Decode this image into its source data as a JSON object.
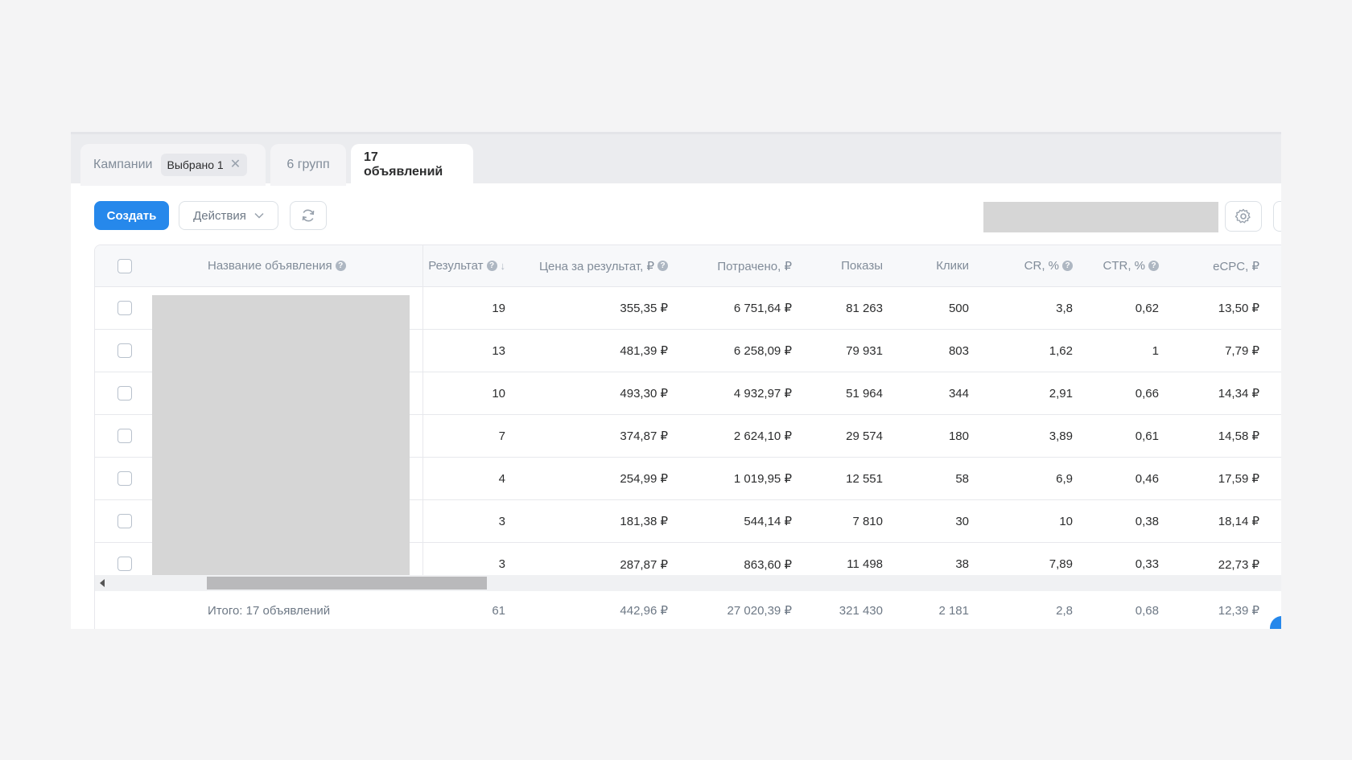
{
  "tabs": {
    "campaigns_label": "Кампании",
    "selected_chip": "Выбрано 1",
    "groups_label": "6 групп",
    "ads_label": "17 объявлений"
  },
  "toolbar": {
    "create_label": "Создать",
    "actions_label": "Действия"
  },
  "table": {
    "headers": {
      "name": "Название объявления",
      "result": "Результат",
      "price": "Цена за результат, ₽",
      "spent": "Потрачено, ₽",
      "shows": "Показы",
      "clicks": "Клики",
      "cr": "CR, %",
      "ctr": "CTR, %",
      "ecpc": "eCPC, ₽"
    },
    "rows": [
      {
        "result": "19",
        "price": "355,35 ₽",
        "spent": "6 751,64 ₽",
        "shows": "81 263",
        "clicks": "500",
        "cr": "3,8",
        "ctr": "0,62",
        "ecpc": "13,50 ₽"
      },
      {
        "result": "13",
        "price": "481,39 ₽",
        "spent": "6 258,09 ₽",
        "shows": "79 931",
        "clicks": "803",
        "cr": "1,62",
        "ctr": "1",
        "ecpc": "7,79 ₽"
      },
      {
        "result": "10",
        "price": "493,30 ₽",
        "spent": "4 932,97 ₽",
        "shows": "51 964",
        "clicks": "344",
        "cr": "2,91",
        "ctr": "0,66",
        "ecpc": "14,34 ₽"
      },
      {
        "result": "7",
        "price": "374,87 ₽",
        "spent": "2 624,10 ₽",
        "shows": "29 574",
        "clicks": "180",
        "cr": "3,89",
        "ctr": "0,61",
        "ecpc": "14,58 ₽"
      },
      {
        "result": "4",
        "price": "254,99 ₽",
        "spent": "1 019,95 ₽",
        "shows": "12 551",
        "clicks": "58",
        "cr": "6,9",
        "ctr": "0,46",
        "ecpc": "17,59 ₽"
      },
      {
        "result": "3",
        "price": "181,38 ₽",
        "spent": "544,14 ₽",
        "shows": "7 810",
        "clicks": "30",
        "cr": "10",
        "ctr": "0,38",
        "ecpc": "18,14 ₽"
      },
      {
        "result": "3",
        "price": "287,87 ₽",
        "spent": "863,60 ₽",
        "shows": "11 498",
        "clicks": "38",
        "cr": "7,89",
        "ctr": "0,33",
        "ecpc": "22,73 ₽"
      }
    ],
    "totals": {
      "label": "Итого: 17 объявлений",
      "result": "61",
      "price": "442,96 ₽",
      "spent": "27 020,39 ₽",
      "shows": "321 430",
      "clicks": "2 181",
      "cr": "2,8",
      "ctr": "0,68",
      "ecpc": "12,39 ₽"
    }
  },
  "icons": {
    "close": "close-icon",
    "chevron": "chevron-down-icon",
    "refresh": "refresh-icon",
    "settings": "gear-icon",
    "help": "question-icon",
    "sort": "sort-down-icon"
  },
  "colors": {
    "accent": "#2688eb",
    "placeholder_gray": "#d6d6d6"
  }
}
